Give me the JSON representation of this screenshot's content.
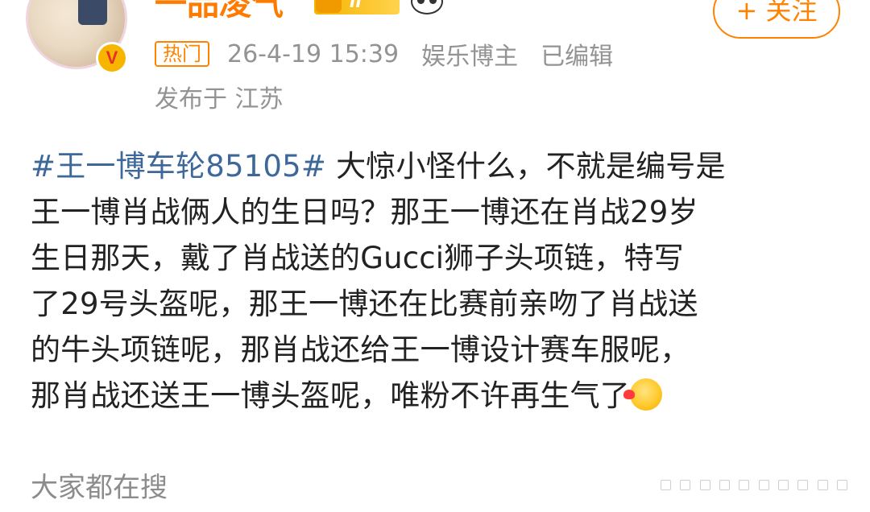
{
  "header": {
    "username": "一品凌气",
    "level_label": "II",
    "follow_label": "+ 关注"
  },
  "meta": {
    "hot_tag": "热门",
    "timestamp": "26-4-19 15:39",
    "category": "娱乐博主",
    "edited": "已编辑",
    "location": "发布于 江苏"
  },
  "post": {
    "topic": "#王一博车轮85105#",
    "lines": [
      " 大惊小怪什么，不就是编号是",
      "王一博肖战俩人的生日吗？那王一博还在肖战29岁",
      "生日那天，戴了肖战送的Gucci狮子头项链，特写",
      "了29号头盔呢，那王一博还在比赛前亲吻了肖战送",
      "的牛头项链呢，那肖战还给王一博设计赛车服呢，",
      "那肖战还送王一博头盔呢，唯粉不许再生气了"
    ]
  },
  "footer": {
    "label": "大家都在搜"
  },
  "colors": {
    "accent_orange": "#ff8200",
    "topic_blue": "#3d6899",
    "meta_gray": "#939393"
  }
}
